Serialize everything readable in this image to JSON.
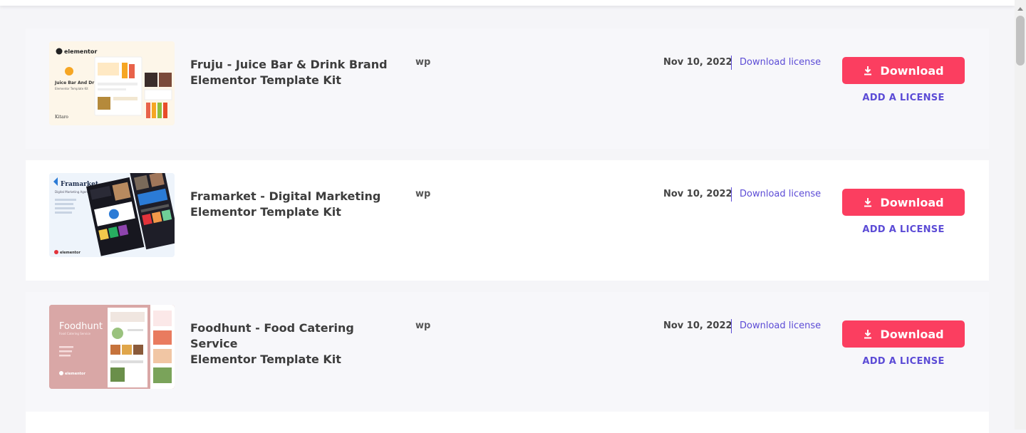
{
  "items": [
    {
      "title_line1": "Fruju - Juice Bar & Drink Brand",
      "title_line2": "Elementor Template Kit",
      "type": "wp",
      "date": "Nov 10, 2022",
      "license_link": "Download license",
      "download_label": "Download",
      "add_license_label": "ADD A LICENSE",
      "thumb": {
        "brand": "elementor",
        "heading": "Juice Bar And Drink",
        "sub": "Elementor Template Kit",
        "footer": "Kitaro",
        "bg": "#fdf6e9"
      }
    },
    {
      "title_line1": "Framarket - Digital Marketing",
      "title_line2": "Elementor Template Kit",
      "type": "wp",
      "date": "Nov 10, 2022",
      "license_link": "Download license",
      "download_label": "Download",
      "add_license_label": "ADD A LICENSE",
      "thumb": {
        "brand": "Framarket",
        "heading": "Digital Marketing Agency Template Kit",
        "footer": "elementor",
        "bg": "#eef4fb"
      }
    },
    {
      "title_line1": "Foodhunt - Food Catering Service",
      "title_line2": "Elementor Template Kit",
      "type": "wp",
      "date": "Nov 10, 2022",
      "license_link": "Download license",
      "download_label": "Download",
      "add_license_label": "ADD A LICENSE",
      "thumb": {
        "brand": "Foodhunt",
        "heading": "Food Catering Service",
        "footer": "elementor",
        "bg": "#d9a7a6"
      }
    }
  ],
  "colors": {
    "accent": "#fb3e60",
    "link": "#5c4cd6"
  }
}
